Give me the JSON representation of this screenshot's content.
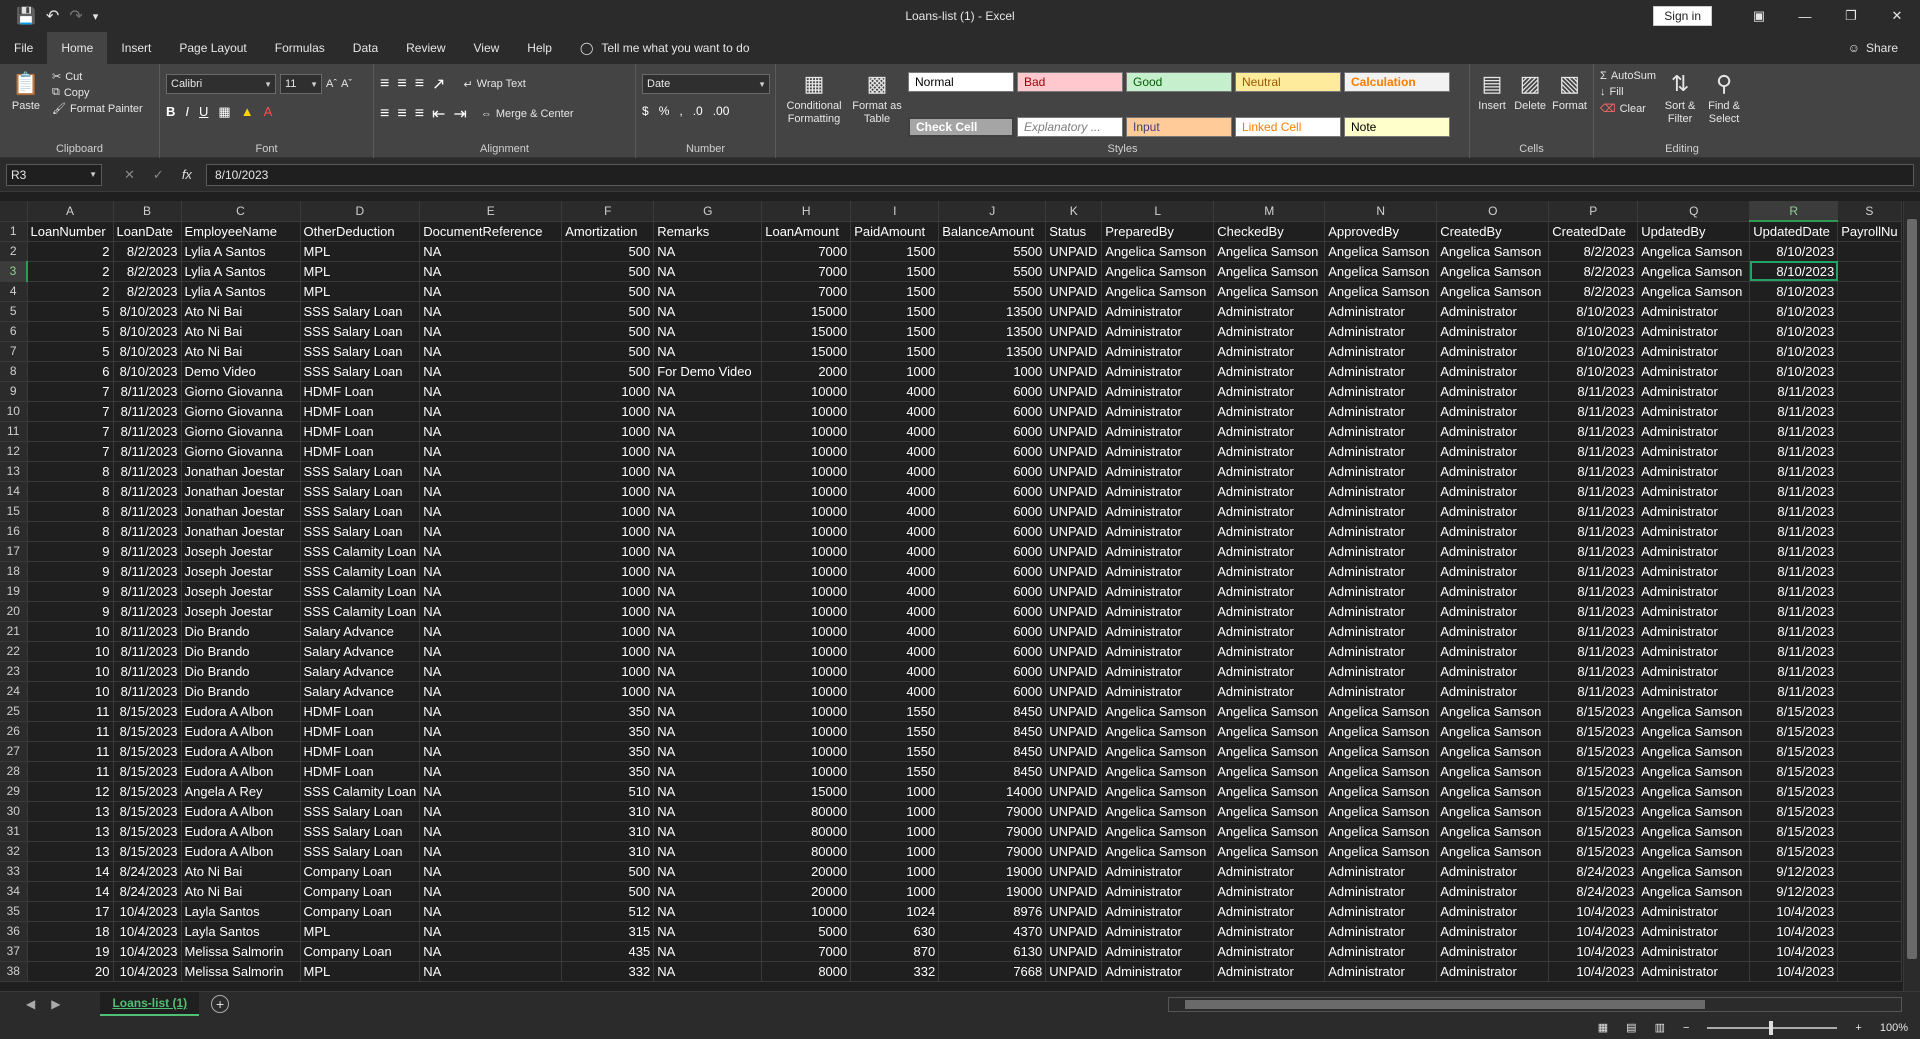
{
  "window": {
    "title": "Loans-list (1)  -  Excel",
    "signin_label": "Sign in"
  },
  "tabs": [
    "File",
    "Home",
    "Insert",
    "Page Layout",
    "Formulas",
    "Data",
    "Review",
    "View",
    "Help"
  ],
  "tell_me": "Tell me what you want to do",
  "share_label": "Share",
  "ribbon": {
    "clipboard": {
      "paste": "Paste",
      "cut": "Cut",
      "copy": "Copy",
      "format_painter": "Format Painter",
      "label": "Clipboard"
    },
    "font": {
      "name": "Calibri",
      "size": "11",
      "label": "Font"
    },
    "alignment": {
      "wrap_text": "Wrap Text",
      "merge_center": "Merge & Center",
      "label": "Alignment"
    },
    "number": {
      "format": "Date",
      "label": "Number"
    },
    "styles": {
      "conditional_formatting": "Conditional Formatting",
      "format_as_table": "Format as Table",
      "normal": "Normal",
      "bad": "Bad",
      "good": "Good",
      "neutral": "Neutral",
      "calculation": "Calculation",
      "check_cell": "Check Cell",
      "explanatory": "Explanatory ...",
      "input": "Input",
      "linked_cell": "Linked Cell",
      "note": "Note",
      "label": "Styles"
    },
    "cells": {
      "insert": "Insert",
      "delete": "Delete",
      "format": "Format",
      "label": "Cells"
    },
    "editing": {
      "autosum": "AutoSum",
      "fill": "Fill",
      "clear": "Clear",
      "sort_filter": "Sort & Filter",
      "find_select": "Find & Select",
      "label": "Editing"
    }
  },
  "formula_bar": {
    "name_box": "R3",
    "formula": "8/10/2023"
  },
  "columns": [
    "A",
    "B",
    "C",
    "D",
    "E",
    "F",
    "G",
    "H",
    "I",
    "J",
    "K",
    "L",
    "M",
    "N",
    "O",
    "P",
    "Q",
    "R",
    "S"
  ],
  "headers": [
    "LoanNumber",
    "LoanDate",
    "EmployeeName",
    "OtherDeduction",
    "DocumentReference",
    "Amortization",
    "Remarks",
    "LoanAmount",
    "PaidAmount",
    "BalanceAmount",
    "Status",
    "PreparedBy",
    "CheckedBy",
    "ApprovedBy",
    "CreatedBy",
    "CreatedDate",
    "UpdatedBy",
    "UpdatedDate",
    "PayrollNu"
  ],
  "rows": [
    [
      "2",
      "8/2/2023",
      "Lylia A Santos",
      "MPL",
      "NA",
      "500",
      "NA",
      "7000",
      "1500",
      "5500",
      "UNPAID",
      "Angelica Samson",
      "Angelica Samson",
      "Angelica Samson",
      "Angelica Samson",
      "8/2/2023",
      "Angelica Samson",
      "8/10/2023",
      ""
    ],
    [
      "2",
      "8/2/2023",
      "Lylia A Santos",
      "MPL",
      "NA",
      "500",
      "NA",
      "7000",
      "1500",
      "5500",
      "UNPAID",
      "Angelica Samson",
      "Angelica Samson",
      "Angelica Samson",
      "Angelica Samson",
      "8/2/2023",
      "Angelica Samson",
      "8/10/2023",
      ""
    ],
    [
      "2",
      "8/2/2023",
      "Lylia A Santos",
      "MPL",
      "NA",
      "500",
      "NA",
      "7000",
      "1500",
      "5500",
      "UNPAID",
      "Angelica Samson",
      "Angelica Samson",
      "Angelica Samson",
      "Angelica Samson",
      "8/2/2023",
      "Angelica Samson",
      "8/10/2023",
      ""
    ],
    [
      "5",
      "8/10/2023",
      "Ato Ni Bai",
      "SSS Salary Loan",
      "NA",
      "500",
      "NA",
      "15000",
      "1500",
      "13500",
      "UNPAID",
      "Administrator",
      "Administrator",
      "Administrator",
      "Administrator",
      "8/10/2023",
      "Administrator",
      "8/10/2023",
      ""
    ],
    [
      "5",
      "8/10/2023",
      "Ato Ni Bai",
      "SSS Salary Loan",
      "NA",
      "500",
      "NA",
      "15000",
      "1500",
      "13500",
      "UNPAID",
      "Administrator",
      "Administrator",
      "Administrator",
      "Administrator",
      "8/10/2023",
      "Administrator",
      "8/10/2023",
      ""
    ],
    [
      "5",
      "8/10/2023",
      "Ato Ni Bai",
      "SSS Salary Loan",
      "NA",
      "500",
      "NA",
      "15000",
      "1500",
      "13500",
      "UNPAID",
      "Administrator",
      "Administrator",
      "Administrator",
      "Administrator",
      "8/10/2023",
      "Administrator",
      "8/10/2023",
      ""
    ],
    [
      "6",
      "8/10/2023",
      "Demo  Video",
      "SSS Salary Loan",
      "NA",
      "500",
      "For Demo Video",
      "2000",
      "1000",
      "1000",
      "UNPAID",
      "Administrator",
      "Administrator",
      "Administrator",
      "Administrator",
      "8/10/2023",
      "Administrator",
      "8/10/2023",
      ""
    ],
    [
      "7",
      "8/11/2023",
      "Giorno  Giovanna",
      "HDMF Loan",
      "NA",
      "1000",
      "NA",
      "10000",
      "4000",
      "6000",
      "UNPAID",
      "Administrator",
      "Administrator",
      "Administrator",
      "Administrator",
      "8/11/2023",
      "Administrator",
      "8/11/2023",
      ""
    ],
    [
      "7",
      "8/11/2023",
      "Giorno  Giovanna",
      "HDMF Loan",
      "NA",
      "1000",
      "NA",
      "10000",
      "4000",
      "6000",
      "UNPAID",
      "Administrator",
      "Administrator",
      "Administrator",
      "Administrator",
      "8/11/2023",
      "Administrator",
      "8/11/2023",
      ""
    ],
    [
      "7",
      "8/11/2023",
      "Giorno  Giovanna",
      "HDMF Loan",
      "NA",
      "1000",
      "NA",
      "10000",
      "4000",
      "6000",
      "UNPAID",
      "Administrator",
      "Administrator",
      "Administrator",
      "Administrator",
      "8/11/2023",
      "Administrator",
      "8/11/2023",
      ""
    ],
    [
      "7",
      "8/11/2023",
      "Giorno  Giovanna",
      "HDMF Loan",
      "NA",
      "1000",
      "NA",
      "10000",
      "4000",
      "6000",
      "UNPAID",
      "Administrator",
      "Administrator",
      "Administrator",
      "Administrator",
      "8/11/2023",
      "Administrator",
      "8/11/2023",
      ""
    ],
    [
      "8",
      "8/11/2023",
      "Jonathan  Joestar",
      "SSS Salary Loan",
      "NA",
      "1000",
      "NA",
      "10000",
      "4000",
      "6000",
      "UNPAID",
      "Administrator",
      "Administrator",
      "Administrator",
      "Administrator",
      "8/11/2023",
      "Administrator",
      "8/11/2023",
      ""
    ],
    [
      "8",
      "8/11/2023",
      "Jonathan  Joestar",
      "SSS Salary Loan",
      "NA",
      "1000",
      "NA",
      "10000",
      "4000",
      "6000",
      "UNPAID",
      "Administrator",
      "Administrator",
      "Administrator",
      "Administrator",
      "8/11/2023",
      "Administrator",
      "8/11/2023",
      ""
    ],
    [
      "8",
      "8/11/2023",
      "Jonathan  Joestar",
      "SSS Salary Loan",
      "NA",
      "1000",
      "NA",
      "10000",
      "4000",
      "6000",
      "UNPAID",
      "Administrator",
      "Administrator",
      "Administrator",
      "Administrator",
      "8/11/2023",
      "Administrator",
      "8/11/2023",
      ""
    ],
    [
      "8",
      "8/11/2023",
      "Jonathan  Joestar",
      "SSS Salary Loan",
      "NA",
      "1000",
      "NA",
      "10000",
      "4000",
      "6000",
      "UNPAID",
      "Administrator",
      "Administrator",
      "Administrator",
      "Administrator",
      "8/11/2023",
      "Administrator",
      "8/11/2023",
      ""
    ],
    [
      "9",
      "8/11/2023",
      "Joseph  Joestar",
      "SSS Calamity Loan",
      "NA",
      "1000",
      "NA",
      "10000",
      "4000",
      "6000",
      "UNPAID",
      "Administrator",
      "Administrator",
      "Administrator",
      "Administrator",
      "8/11/2023",
      "Administrator",
      "8/11/2023",
      ""
    ],
    [
      "9",
      "8/11/2023",
      "Joseph  Joestar",
      "SSS Calamity Loan",
      "NA",
      "1000",
      "NA",
      "10000",
      "4000",
      "6000",
      "UNPAID",
      "Administrator",
      "Administrator",
      "Administrator",
      "Administrator",
      "8/11/2023",
      "Administrator",
      "8/11/2023",
      ""
    ],
    [
      "9",
      "8/11/2023",
      "Joseph  Joestar",
      "SSS Calamity Loan",
      "NA",
      "1000",
      "NA",
      "10000",
      "4000",
      "6000",
      "UNPAID",
      "Administrator",
      "Administrator",
      "Administrator",
      "Administrator",
      "8/11/2023",
      "Administrator",
      "8/11/2023",
      ""
    ],
    [
      "9",
      "8/11/2023",
      "Joseph  Joestar",
      "SSS Calamity Loan",
      "NA",
      "1000",
      "NA",
      "10000",
      "4000",
      "6000",
      "UNPAID",
      "Administrator",
      "Administrator",
      "Administrator",
      "Administrator",
      "8/11/2023",
      "Administrator",
      "8/11/2023",
      ""
    ],
    [
      "10",
      "8/11/2023",
      "Dio  Brando",
      "Salary Advance",
      "NA",
      "1000",
      "NA",
      "10000",
      "4000",
      "6000",
      "UNPAID",
      "Administrator",
      "Administrator",
      "Administrator",
      "Administrator",
      "8/11/2023",
      "Administrator",
      "8/11/2023",
      ""
    ],
    [
      "10",
      "8/11/2023",
      "Dio  Brando",
      "Salary Advance",
      "NA",
      "1000",
      "NA",
      "10000",
      "4000",
      "6000",
      "UNPAID",
      "Administrator",
      "Administrator",
      "Administrator",
      "Administrator",
      "8/11/2023",
      "Administrator",
      "8/11/2023",
      ""
    ],
    [
      "10",
      "8/11/2023",
      "Dio  Brando",
      "Salary Advance",
      "NA",
      "1000",
      "NA",
      "10000",
      "4000",
      "6000",
      "UNPAID",
      "Administrator",
      "Administrator",
      "Administrator",
      "Administrator",
      "8/11/2023",
      "Administrator",
      "8/11/2023",
      ""
    ],
    [
      "10",
      "8/11/2023",
      "Dio  Brando",
      "Salary Advance",
      "NA",
      "1000",
      "NA",
      "10000",
      "4000",
      "6000",
      "UNPAID",
      "Administrator",
      "Administrator",
      "Administrator",
      "Administrator",
      "8/11/2023",
      "Administrator",
      "8/11/2023",
      ""
    ],
    [
      "11",
      "8/15/2023",
      "Eudora A Albon",
      "HDMF Loan",
      "NA",
      "350",
      "NA",
      "10000",
      "1550",
      "8450",
      "UNPAID",
      "Angelica Samson",
      "Angelica Samson",
      "Angelica Samson",
      "Angelica Samson",
      "8/15/2023",
      "Angelica Samson",
      "8/15/2023",
      ""
    ],
    [
      "11",
      "8/15/2023",
      "Eudora A Albon",
      "HDMF Loan",
      "NA",
      "350",
      "NA",
      "10000",
      "1550",
      "8450",
      "UNPAID",
      "Angelica Samson",
      "Angelica Samson",
      "Angelica Samson",
      "Angelica Samson",
      "8/15/2023",
      "Angelica Samson",
      "8/15/2023",
      ""
    ],
    [
      "11",
      "8/15/2023",
      "Eudora A Albon",
      "HDMF Loan",
      "NA",
      "350",
      "NA",
      "10000",
      "1550",
      "8450",
      "UNPAID",
      "Angelica Samson",
      "Angelica Samson",
      "Angelica Samson",
      "Angelica Samson",
      "8/15/2023",
      "Angelica Samson",
      "8/15/2023",
      ""
    ],
    [
      "11",
      "8/15/2023",
      "Eudora A Albon",
      "HDMF Loan",
      "NA",
      "350",
      "NA",
      "10000",
      "1550",
      "8450",
      "UNPAID",
      "Angelica Samson",
      "Angelica Samson",
      "Angelica Samson",
      "Angelica Samson",
      "8/15/2023",
      "Angelica Samson",
      "8/15/2023",
      ""
    ],
    [
      "12",
      "8/15/2023",
      "Angela A Rey",
      "SSS Calamity Loan",
      "NA",
      "510",
      "NA",
      "15000",
      "1000",
      "14000",
      "UNPAID",
      "Angelica Samson",
      "Angelica Samson",
      "Angelica Samson",
      "Angelica Samson",
      "8/15/2023",
      "Angelica Samson",
      "8/15/2023",
      ""
    ],
    [
      "13",
      "8/15/2023",
      "Eudora A Albon",
      "SSS Salary Loan",
      "NA",
      "310",
      "NA",
      "80000",
      "1000",
      "79000",
      "UNPAID",
      "Angelica Samson",
      "Angelica Samson",
      "Angelica Samson",
      "Angelica Samson",
      "8/15/2023",
      "Angelica Samson",
      "8/15/2023",
      ""
    ],
    [
      "13",
      "8/15/2023",
      "Eudora A Albon",
      "SSS Salary Loan",
      "NA",
      "310",
      "NA",
      "80000",
      "1000",
      "79000",
      "UNPAID",
      "Angelica Samson",
      "Angelica Samson",
      "Angelica Samson",
      "Angelica Samson",
      "8/15/2023",
      "Angelica Samson",
      "8/15/2023",
      ""
    ],
    [
      "13",
      "8/15/2023",
      "Eudora A Albon",
      "SSS Salary Loan",
      "NA",
      "310",
      "NA",
      "80000",
      "1000",
      "79000",
      "UNPAID",
      "Angelica Samson",
      "Angelica Samson",
      "Angelica Samson",
      "Angelica Samson",
      "8/15/2023",
      "Angelica Samson",
      "8/15/2023",
      ""
    ],
    [
      "14",
      "8/24/2023",
      "Ato Ni Bai",
      "Company Loan",
      "NA",
      "500",
      "NA",
      "20000",
      "1000",
      "19000",
      "UNPAID",
      "Administrator",
      "Administrator",
      "Administrator",
      "Administrator",
      "8/24/2023",
      "Angelica Samson",
      "9/12/2023",
      ""
    ],
    [
      "14",
      "8/24/2023",
      "Ato Ni Bai",
      "Company Loan",
      "NA",
      "500",
      "NA",
      "20000",
      "1000",
      "19000",
      "UNPAID",
      "Administrator",
      "Administrator",
      "Administrator",
      "Administrator",
      "8/24/2023",
      "Angelica Samson",
      "9/12/2023",
      ""
    ],
    [
      "17",
      "10/4/2023",
      "Layla  Santos",
      "Company Loan",
      "NA",
      "512",
      "NA",
      "10000",
      "1024",
      "8976",
      "UNPAID",
      "Administrator",
      "Administrator",
      "Administrator",
      "Administrator",
      "10/4/2023",
      "Administrator",
      "10/4/2023",
      ""
    ],
    [
      "18",
      "10/4/2023",
      "Layla  Santos",
      "MPL",
      "NA",
      "315",
      "NA",
      "5000",
      "630",
      "4370",
      "UNPAID",
      "Administrator",
      "Administrator",
      "Administrator",
      "Administrator",
      "10/4/2023",
      "Administrator",
      "10/4/2023",
      ""
    ],
    [
      "19",
      "10/4/2023",
      "Melissa  Salmorin",
      "Company Loan",
      "NA",
      "435",
      "NA",
      "7000",
      "870",
      "6130",
      "UNPAID",
      "Administrator",
      "Administrator",
      "Administrator",
      "Administrator",
      "10/4/2023",
      "Administrator",
      "10/4/2023",
      ""
    ],
    [
      "20",
      "10/4/2023",
      "Melissa  Salmorin",
      "MPL",
      "NA",
      "332",
      "NA",
      "8000",
      "332",
      "7668",
      "UNPAID",
      "Administrator",
      "Administrator",
      "Administrator",
      "Administrator",
      "10/4/2023",
      "Administrator",
      "10/4/2023",
      ""
    ]
  ],
  "sheet_tab": "Loans-list (1)",
  "zoom": "100%",
  "colors": {
    "accent": "#21a366",
    "sheet_tab": "#4fc074"
  }
}
